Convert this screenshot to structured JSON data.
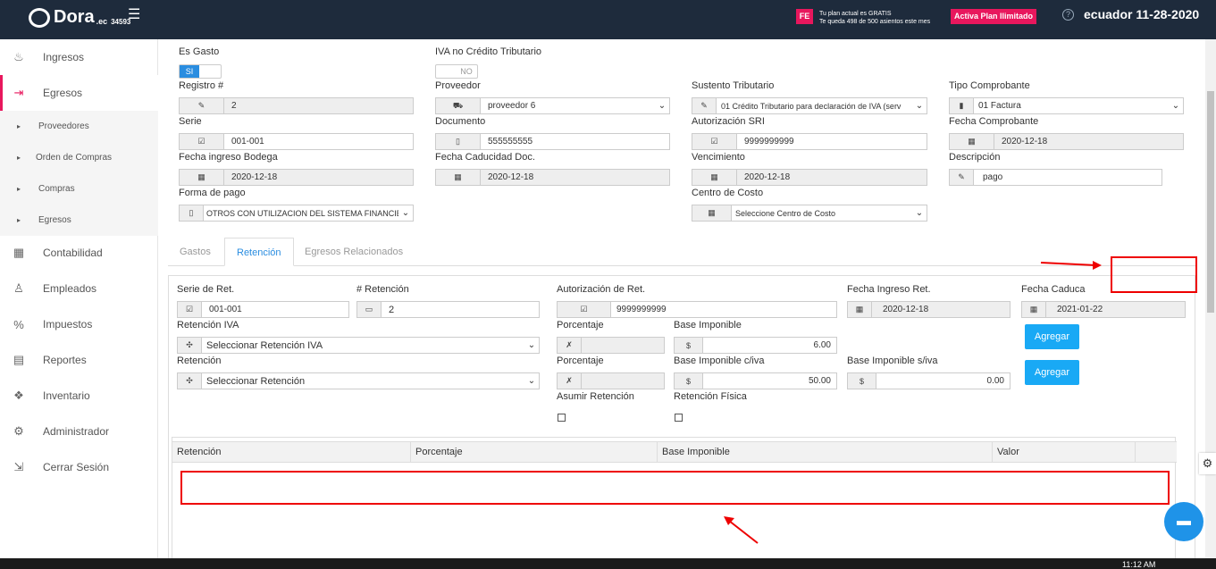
{
  "header": {
    "logo_text": "Dora",
    "logo_suffix": ".ec",
    "account_number": "34593",
    "fe_badge": "FE",
    "plan_line1": "Tu plan actual es GRATIS",
    "plan_line2": "Te queda 498 de 500 asientos este mes",
    "activate_label": "Activa Plan Ilimitado",
    "help_icon": "question-circle-icon",
    "user_info": "ecuador 11-28-2020"
  },
  "sidebar": {
    "items": [
      {
        "label": "Ingresos",
        "icon": "hand-coin-icon"
      },
      {
        "label": "Egresos",
        "icon": "exit-money-icon"
      },
      {
        "label": "Contabilidad",
        "icon": "calculator-icon"
      },
      {
        "label": "Empleados",
        "icon": "people-icon"
      },
      {
        "label": "Impuestos",
        "icon": "tax-icon"
      },
      {
        "label": "Reportes",
        "icon": "report-icon"
      },
      {
        "label": "Inventario",
        "icon": "boxes-icon"
      },
      {
        "label": "Administrador",
        "icon": "gear-icon"
      },
      {
        "label": "Cerrar Sesión",
        "icon": "logout-icon"
      }
    ],
    "subitems": [
      "Proveedores",
      "Orden de Compras",
      "Compras",
      "Egresos"
    ]
  },
  "form": {
    "es_gasto": {
      "label": "Es Gasto",
      "value": "SI"
    },
    "iva_no_credito": {
      "label": "IVA no Crédito Tributario",
      "value": "NO"
    },
    "registro": {
      "label": "Registro #",
      "value": "2"
    },
    "proveedor": {
      "label": "Proveedor",
      "value": "proveedor 6"
    },
    "sustento": {
      "label": "Sustento Tributario",
      "value": "01 Crédito Tributario para declaración de IVA (serv"
    },
    "tipo_comprobante": {
      "label": "Tipo Comprobante",
      "value": "01 Factura"
    },
    "serie": {
      "label": "Serie",
      "value": "001-001"
    },
    "documento": {
      "label": "Documento",
      "value": "555555555"
    },
    "autorizacion_sri": {
      "label": "Autorización SRI",
      "value": "9999999999"
    },
    "fecha_comprobante": {
      "label": "Fecha Comprobante",
      "value": "2020-12-18"
    },
    "fecha_ingreso": {
      "label": "Fecha ingreso Bodega",
      "value": "2020-12-18"
    },
    "fecha_caducidad": {
      "label": "Fecha Caducidad Doc.",
      "value": "2020-12-18"
    },
    "vencimiento": {
      "label": "Vencimiento",
      "value": "2020-12-18"
    },
    "descripcion": {
      "label": "Descripción",
      "value": "pago"
    },
    "forma_pago": {
      "label": "Forma de pago",
      "value": "OTROS CON UTILIZACION DEL SISTEMA FINANCIERO"
    },
    "centro_costo": {
      "label": "Centro de Costo",
      "value": "Seleccione Centro de Costo"
    }
  },
  "tabs": [
    "Gastos",
    "Retención",
    "Egresos Relacionados"
  ],
  "retencion": {
    "serie": {
      "label": "Serie de Ret.",
      "value": "001-001"
    },
    "numero": {
      "label": "# Retención",
      "value": "2"
    },
    "autorizacion": {
      "label": "Autorización de Ret.",
      "value": "9999999999"
    },
    "fecha_ingreso": {
      "label": "Fecha Ingreso Ret.",
      "value": "2020-12-18"
    },
    "fecha_caduca": {
      "label": "Fecha Caduca",
      "value": "2021-01-22"
    },
    "ret_iva": {
      "label": "Retención IVA",
      "value": "Seleccionar Retención IVA"
    },
    "porcentaje_label": "Porcentaje",
    "base_imponible": {
      "label": "Base Imponible",
      "value": "6.00"
    },
    "ret": {
      "label": "Retención",
      "value": "Seleccionar Retención"
    },
    "base_con_iva": {
      "label": "Base Imponible c/iva",
      "value": "50.00"
    },
    "base_sin_iva": {
      "label": "Base Imponible s/iva",
      "value": "0.00"
    },
    "asumir_label": "Asumir Retención",
    "fisica_label": "Retención Física",
    "agregar_label": "Agregar",
    "currency": "$"
  },
  "table": {
    "columns": [
      "Retención",
      "Porcentaje",
      "Base Imponible",
      "Valor"
    ]
  },
  "taskbar": {
    "time": "11:12 AM"
  }
}
